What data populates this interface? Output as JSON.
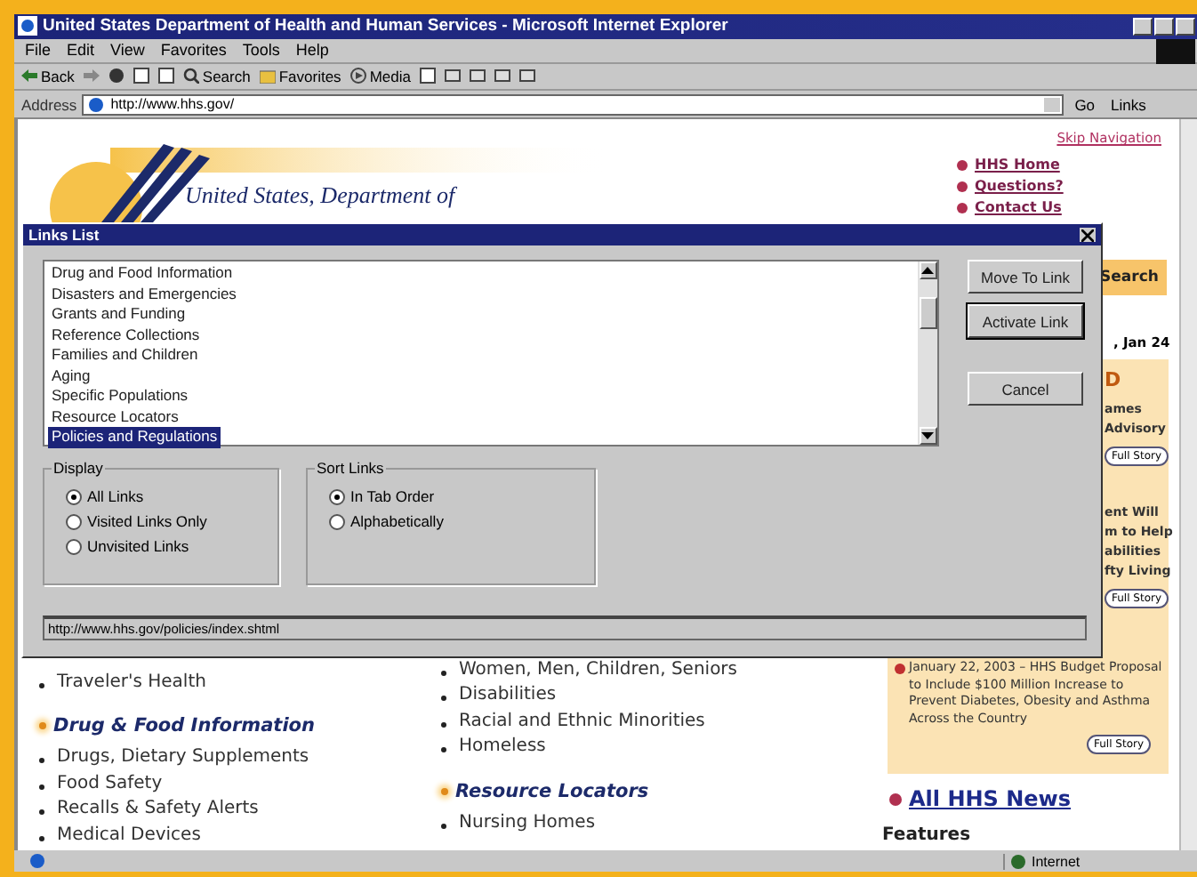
{
  "window": {
    "title": "United States Department of Health and Human Services - Microsoft Internet Explorer"
  },
  "menu": [
    "File",
    "Edit",
    "View",
    "Favorites",
    "Tools",
    "Help"
  ],
  "toolbar": [
    {
      "kind": "back",
      "label": "Back"
    },
    {
      "kind": "forward"
    },
    {
      "kind": "stop"
    },
    {
      "kind": "refresh"
    },
    {
      "kind": "home"
    },
    {
      "kind": "search",
      "label": "Search"
    },
    {
      "kind": "favorites",
      "label": "Favorites"
    },
    {
      "kind": "media",
      "label": "Media"
    },
    {
      "kind": "history"
    },
    {
      "kind": "mail"
    },
    {
      "kind": "print"
    },
    {
      "kind": "edit"
    },
    {
      "kind": "discuss"
    }
  ],
  "address": {
    "label": "Address",
    "value": "http://www.hhs.gov/",
    "go": "Go",
    "links": "Links"
  },
  "page": {
    "skip_link": "Skip Navigation",
    "logo_text": "United States, Department of",
    "top_links": [
      "HHS Home",
      "Questions?",
      "Contact Us"
    ],
    "search_button": "Search",
    "date": ", Jan 24",
    "feature_lines": [
      {
        "kind": "heading",
        "text": "D"
      },
      {
        "kind": "text",
        "text": "ames"
      },
      {
        "kind": "text",
        "text": "Advisory"
      },
      {
        "kind": "button",
        "text": "Full Story"
      },
      {
        "kind": "gap"
      },
      {
        "kind": "text",
        "text": "ent Will"
      },
      {
        "kind": "text",
        "text": "m to Help"
      },
      {
        "kind": "text",
        "text": "abilities"
      },
      {
        "kind": "text",
        "text": "fty Living"
      },
      {
        "kind": "button",
        "text": "Full Story"
      }
    ],
    "news": {
      "text": "January 22, 2003 – HHS Budget Proposal to Include $100 Million Increase to Prevent Diabetes, Obesity and Asthma Across the Country",
      "button": "Full Story"
    },
    "all_news": "All HHS News",
    "features": "Features",
    "left_column": [
      {
        "kind": "item",
        "text": "Traveler's Health"
      },
      {
        "kind": "heading",
        "text": "Drug & Food Information"
      },
      {
        "kind": "item",
        "text": "Drugs, Dietary Supplements"
      },
      {
        "kind": "item",
        "text": "Food Safety"
      },
      {
        "kind": "item",
        "text": "Recalls & Safety Alerts"
      },
      {
        "kind": "item",
        "text": "Medical Devices"
      }
    ],
    "middle_column": [
      {
        "kind": "item",
        "text": "Women, Men, Children, Seniors"
      },
      {
        "kind": "item",
        "text": "Disabilities"
      },
      {
        "kind": "item",
        "text": "Racial and Ethnic Minorities"
      },
      {
        "kind": "item",
        "text": "Homeless"
      },
      {
        "kind": "heading",
        "text": "Resource Locators"
      },
      {
        "kind": "item",
        "text": "Nursing Homes"
      }
    ]
  },
  "dialog": {
    "title": "Links List",
    "links": [
      {
        "label": "Drug and Food Information",
        "selected": false
      },
      {
        "label": "Disasters and Emergencies",
        "selected": false
      },
      {
        "label": "Grants and Funding",
        "selected": false
      },
      {
        "label": "Reference Collections",
        "selected": false
      },
      {
        "label": "Families and Children",
        "selected": false
      },
      {
        "label": "Aging",
        "selected": false
      },
      {
        "label": "Specific Populations",
        "selected": false
      },
      {
        "label": "Resource Locators",
        "selected": false
      },
      {
        "label": "Policies and Regulations",
        "selected": true
      }
    ],
    "buttons": [
      {
        "label": "Move To Link",
        "default": false
      },
      {
        "label": "Activate Link",
        "default": true
      },
      {
        "label": "Cancel",
        "default": false
      }
    ],
    "display": {
      "title": "Display",
      "options": [
        {
          "label": "All Links",
          "selected": true
        },
        {
          "label": "Visited Links Only",
          "selected": false
        },
        {
          "label": "Unvisited Links",
          "selected": false
        }
      ]
    },
    "sort": {
      "title": "Sort Links",
      "options": [
        {
          "label": "In Tab Order",
          "selected": true
        },
        {
          "label": "Alphabetically",
          "selected": false
        }
      ]
    },
    "url": "http://www.hhs.gov/policies/index.shtml"
  },
  "status_bar": {
    "zone": "Internet"
  }
}
